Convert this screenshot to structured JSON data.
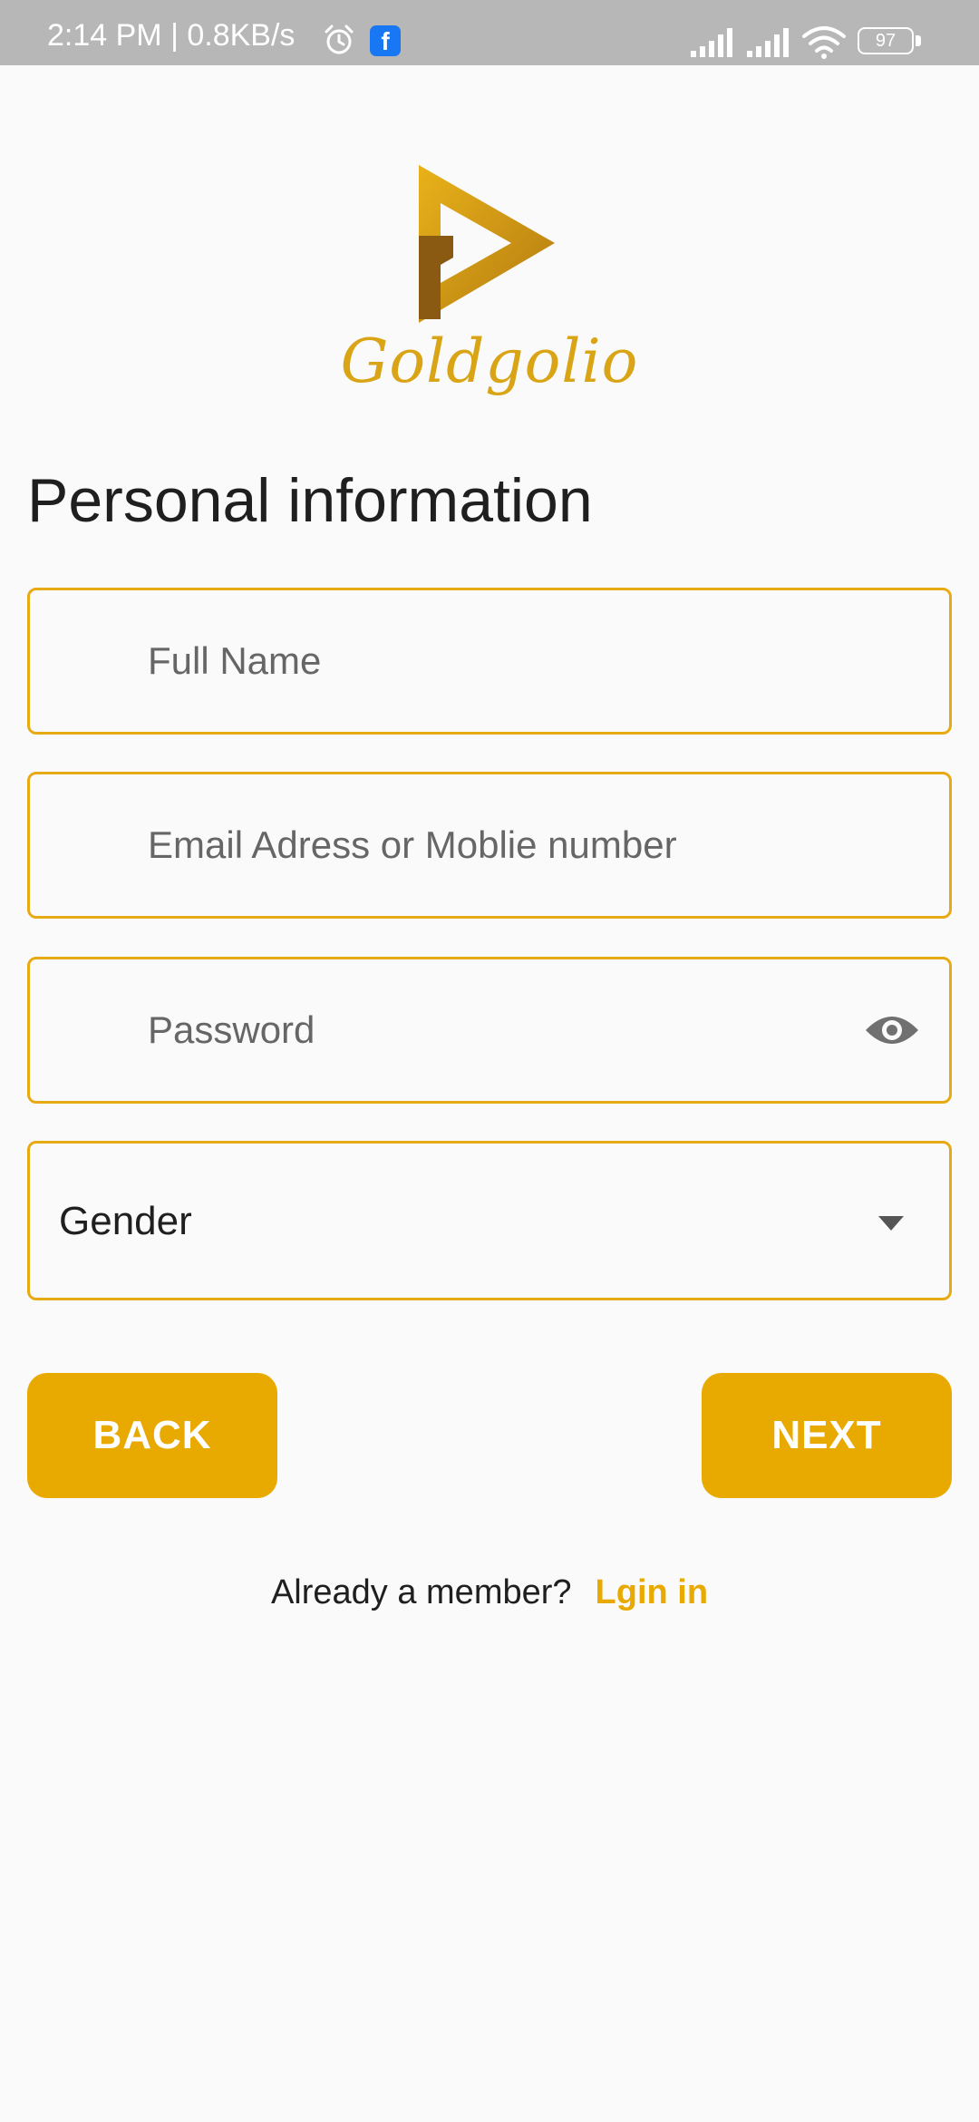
{
  "status_bar": {
    "time_speed": "2:14 PM | 0.8KB/s",
    "icons": [
      "alarm-icon",
      "facebook-icon",
      "signal-icon",
      "signal-icon",
      "wifi-icon",
      "battery-icon"
    ],
    "battery_level": "97"
  },
  "logo": {
    "name": "Goldgolio",
    "icon": "play-logo-icon",
    "color": "#d9a516"
  },
  "page": {
    "title": "Personal information"
  },
  "form": {
    "full_name_placeholder": "Full Name",
    "email_placeholder": "Email Adress or Moblie number",
    "password_placeholder": "Password",
    "gender_label": "Gender"
  },
  "buttons": {
    "back": "BACK",
    "next": "NEXT"
  },
  "footer": {
    "question": "Already a member?",
    "login_link": "Lgin in"
  },
  "colors": {
    "accent": "#e8a900",
    "border": "#e8aa14",
    "background": "#fafafa",
    "status_bar": "#b7b7b7"
  }
}
